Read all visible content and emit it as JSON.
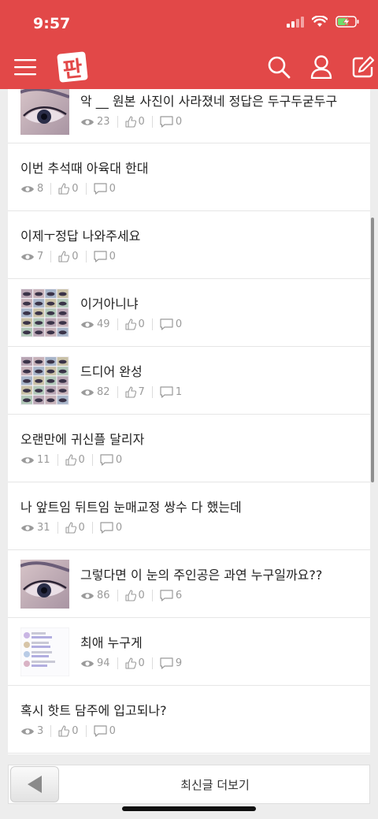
{
  "status": {
    "time": "9:57"
  },
  "header": {
    "logo_text": "판"
  },
  "posts": [
    {
      "title": "악 __ 원본 사진이 사라졌네 정답은 두구두굳두구",
      "views": "23",
      "likes": "0",
      "comments": "0",
      "thumb": "eye"
    },
    {
      "title": "이번 추석때 아육대 한대",
      "views": "8",
      "likes": "0",
      "comments": "0",
      "thumb": ""
    },
    {
      "title": "이제ㅜ정답 나와주세요",
      "views": "7",
      "likes": "0",
      "comments": "0",
      "thumb": ""
    },
    {
      "title": "이거아니냐",
      "views": "49",
      "likes": "0",
      "comments": "0",
      "thumb": "grid"
    },
    {
      "title": "드디어 완성",
      "views": "82",
      "likes": "7",
      "comments": "1",
      "thumb": "grid"
    },
    {
      "title": "오랜만에 귀신플 달리자",
      "views": "11",
      "likes": "0",
      "comments": "0",
      "thumb": ""
    },
    {
      "title": "나 앞트임 뒤트임 눈매교정 쌍수 다 했는데",
      "views": "31",
      "likes": "0",
      "comments": "0",
      "thumb": ""
    },
    {
      "title": "그렇다면 이 눈의 주인공은 과연 누구일까요??",
      "views": "86",
      "likes": "0",
      "comments": "6",
      "thumb": "eye"
    },
    {
      "title": "최애 누구게",
      "views": "94",
      "likes": "0",
      "comments": "9",
      "thumb": "chat"
    },
    {
      "title": "혹시 핫트 담주에 입고되나?",
      "views": "3",
      "likes": "0",
      "comments": "0",
      "thumb": ""
    }
  ],
  "footer": {
    "more_label": "최신글 더보기"
  },
  "colors": {
    "header": "#e24848",
    "meta": "#9a9a9a"
  }
}
